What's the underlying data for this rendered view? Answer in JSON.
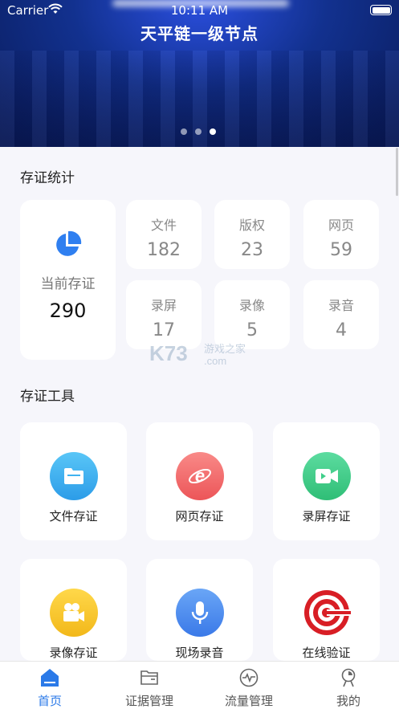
{
  "status_bar": {
    "carrier": "Carrier",
    "time": "10:11 AM"
  },
  "banner": {
    "title": "天平链一级节点",
    "dots": 3,
    "active_dot": 3
  },
  "stats": {
    "heading": "存证统计",
    "total": {
      "label": "当前存证",
      "value": "290"
    },
    "items": [
      {
        "label": "文件",
        "value": "182"
      },
      {
        "label": "版权",
        "value": "23"
      },
      {
        "label": "网页",
        "value": "59"
      },
      {
        "label": "录屏",
        "value": "17"
      },
      {
        "label": "录像",
        "value": "5"
      },
      {
        "label": "录音",
        "value": "4"
      }
    ]
  },
  "tools": {
    "heading": "存证工具",
    "items": [
      {
        "label": "文件存证",
        "icon": "folder-icon",
        "color": "#3fb2f0"
      },
      {
        "label": "网页存证",
        "icon": "browser-e-icon",
        "color": "#f2676a"
      },
      {
        "label": "录屏存证",
        "icon": "video-camera-icon",
        "color": "#3fcf8a"
      },
      {
        "label": "录像存证",
        "icon": "camcorder-icon",
        "color": "#f6c52a"
      },
      {
        "label": "现场录音",
        "icon": "microphone-icon",
        "color": "#4a8cf0"
      },
      {
        "label": "在线验证",
        "icon": "verify-seal-icon",
        "color": "#d81e25"
      }
    ]
  },
  "watermark": {
    "brand": "K73",
    "text": "游戏之家",
    "domain": ".com"
  },
  "tabbar": {
    "items": [
      {
        "label": "首页",
        "icon": "home-icon",
        "active": true
      },
      {
        "label": "证据管理",
        "icon": "folder-outline-icon",
        "active": false
      },
      {
        "label": "流量管理",
        "icon": "pulse-icon",
        "active": false
      },
      {
        "label": "我的",
        "icon": "profile-icon",
        "active": false
      }
    ],
    "active_color": "#2b7ae8"
  }
}
